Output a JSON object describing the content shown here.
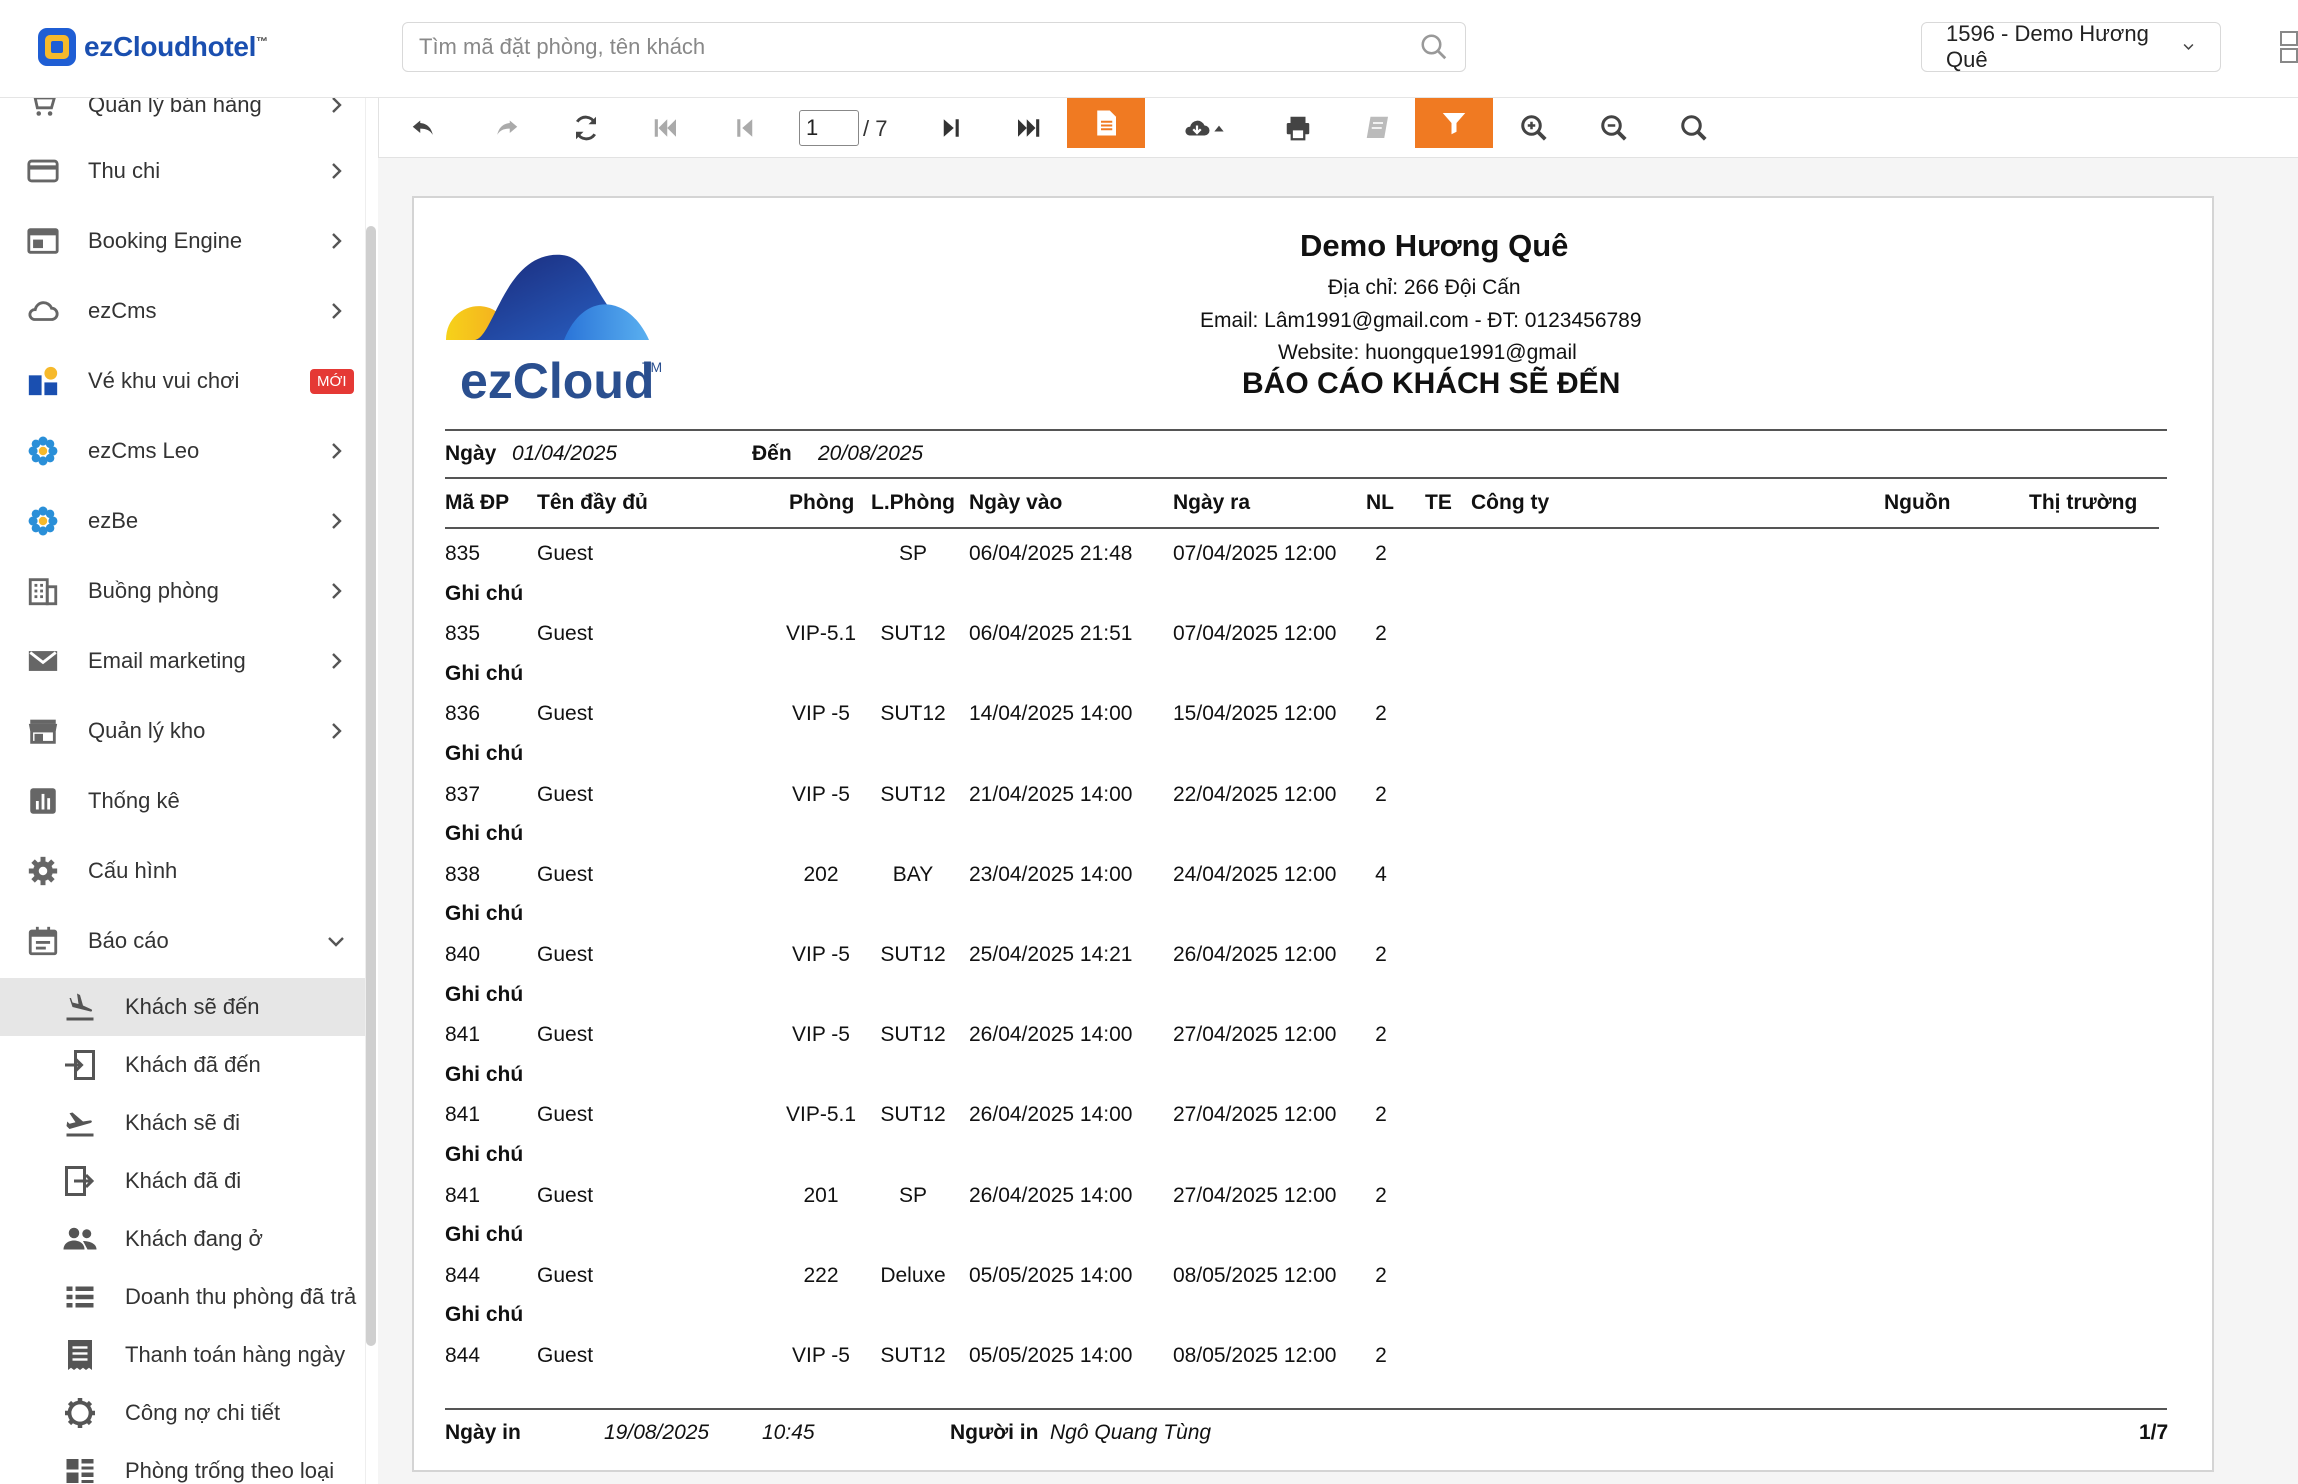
{
  "header": {
    "app_name": "ezCloudhotel",
    "tm": "™",
    "search_placeholder": "Tìm mã đặt phòng, tên khách",
    "hotel_selector": "1596 - Demo Hương Quê"
  },
  "sidebar": {
    "items": [
      {
        "label": "Quản lý bán hàng",
        "icon": "cart-icon"
      },
      {
        "label": "Thu chi",
        "icon": "card-icon"
      },
      {
        "label": "Booking Engine",
        "icon": "browser-icon"
      },
      {
        "label": "ezCms",
        "icon": "cloud-icon"
      },
      {
        "label": "Vé khu vui chơi",
        "icon": "ticket-app-icon",
        "badge": "MỚI"
      },
      {
        "label": "ezCms Leo",
        "icon": "flower-icon"
      },
      {
        "label": "ezBe",
        "icon": "flower-icon"
      },
      {
        "label": "Buồng phòng",
        "icon": "building-icon"
      },
      {
        "label": "Email marketing",
        "icon": "mail-icon"
      },
      {
        "label": "Quản lý kho",
        "icon": "store-icon"
      },
      {
        "label": "Thống kê",
        "icon": "bar-chart-icon"
      },
      {
        "label": "Cấu hình",
        "icon": "gear-icon"
      },
      {
        "label": "Báo cáo",
        "icon": "calendar-icon"
      }
    ],
    "sub_items": [
      {
        "label": "Khách sẽ đến",
        "icon": "plane-landing-icon",
        "active": true
      },
      {
        "label": "Khách đã đến",
        "icon": "login-icon"
      },
      {
        "label": "Khách sẽ đi",
        "icon": "plane-takeoff-icon"
      },
      {
        "label": "Khách đã đi",
        "icon": "login-icon"
      },
      {
        "label": "Khách đang ở",
        "icon": "people-icon"
      },
      {
        "label": "Doanh thu phòng đã trả",
        "icon": "list-icon"
      },
      {
        "label": "Thanh toán hàng ngày",
        "icon": "receipt-icon"
      },
      {
        "label": "Công nợ chi tiết",
        "icon": "gear-outline-icon"
      },
      {
        "label": "Phòng trống theo loại",
        "icon": "grid-list-icon"
      }
    ]
  },
  "toolbar": {
    "page_current": "1",
    "page_total": "/ 7"
  },
  "report": {
    "logo_text": "ezCloud",
    "logo_tm": "TM",
    "hotel_name": "Demo Hương Quê",
    "address": "Địa chỉ: 266 Đội Cấn",
    "contact": "Email: Lâm1991@gmail.com -  ĐT: 0123456789",
    "website": "Website: huongque1991@gmail",
    "title": "BÁO CÁO KHÁCH SẼ ĐẾN",
    "date_label": "Ngày",
    "date_from": "01/04/2025",
    "to_label": "Đến",
    "date_to": "20/08/2025",
    "columns": [
      "Mã ĐP",
      "Tên đầy đủ",
      "Phòng",
      "L.Phòng",
      "Ngày vào",
      "Ngày ra",
      "NL",
      "TE",
      "Công ty",
      "Nguồn",
      "Thị trường"
    ],
    "note_label": "Ghi chú",
    "rows": [
      {
        "ma": "835",
        "ten": "Guest",
        "phong": "",
        "loai": "SP",
        "vao": "06/04/2025 21:48",
        "ra": "07/04/2025 12:00",
        "nl": "2"
      },
      {
        "ma": "835",
        "ten": "Guest",
        "phong": "VIP-5.1",
        "loai": "SUT12",
        "vao": "06/04/2025 21:51",
        "ra": "07/04/2025 12:00",
        "nl": "2"
      },
      {
        "ma": "836",
        "ten": "Guest",
        "phong": "VIP -5",
        "loai": "SUT12",
        "vao": "14/04/2025 14:00",
        "ra": "15/04/2025 12:00",
        "nl": "2"
      },
      {
        "ma": "837",
        "ten": "Guest",
        "phong": "VIP -5",
        "loai": "SUT12",
        "vao": "21/04/2025 14:00",
        "ra": "22/04/2025 12:00",
        "nl": "2"
      },
      {
        "ma": "838",
        "ten": "Guest",
        "phong": "202",
        "loai": "BAY",
        "vao": "23/04/2025 14:00",
        "ra": "24/04/2025 12:00",
        "nl": "4"
      },
      {
        "ma": "840",
        "ten": "Guest",
        "phong": "VIP -5",
        "loai": "SUT12",
        "vao": "25/04/2025 14:21",
        "ra": "26/04/2025 12:00",
        "nl": "2"
      },
      {
        "ma": "841",
        "ten": "Guest",
        "phong": "VIP -5",
        "loai": "SUT12",
        "vao": "26/04/2025 14:00",
        "ra": "27/04/2025 12:00",
        "nl": "2"
      },
      {
        "ma": "841",
        "ten": "Guest",
        "phong": "VIP-5.1",
        "loai": "SUT12",
        "vao": "26/04/2025 14:00",
        "ra": "27/04/2025 12:00",
        "nl": "2"
      },
      {
        "ma": "841",
        "ten": "Guest",
        "phong": "201",
        "loai": "SP",
        "vao": "26/04/2025 14:00",
        "ra": "27/04/2025 12:00",
        "nl": "2"
      },
      {
        "ma": "844",
        "ten": "Guest",
        "phong": "222",
        "loai": "Deluxe",
        "vao": "05/05/2025 14:00",
        "ra": "08/05/2025 12:00",
        "nl": "2"
      },
      {
        "ma": "844",
        "ten": "Guest",
        "phong": "VIP -5",
        "loai": "SUT12",
        "vao": "05/05/2025 14:00",
        "ra": "08/05/2025 12:00",
        "nl": "2"
      }
    ],
    "footer": {
      "print_date_label": "Ngày in",
      "print_date": "19/08/2025",
      "print_time": "10:45",
      "printer_label": "Người in",
      "printer": "Ngô Quang Tùng",
      "page": "1/7"
    }
  }
}
